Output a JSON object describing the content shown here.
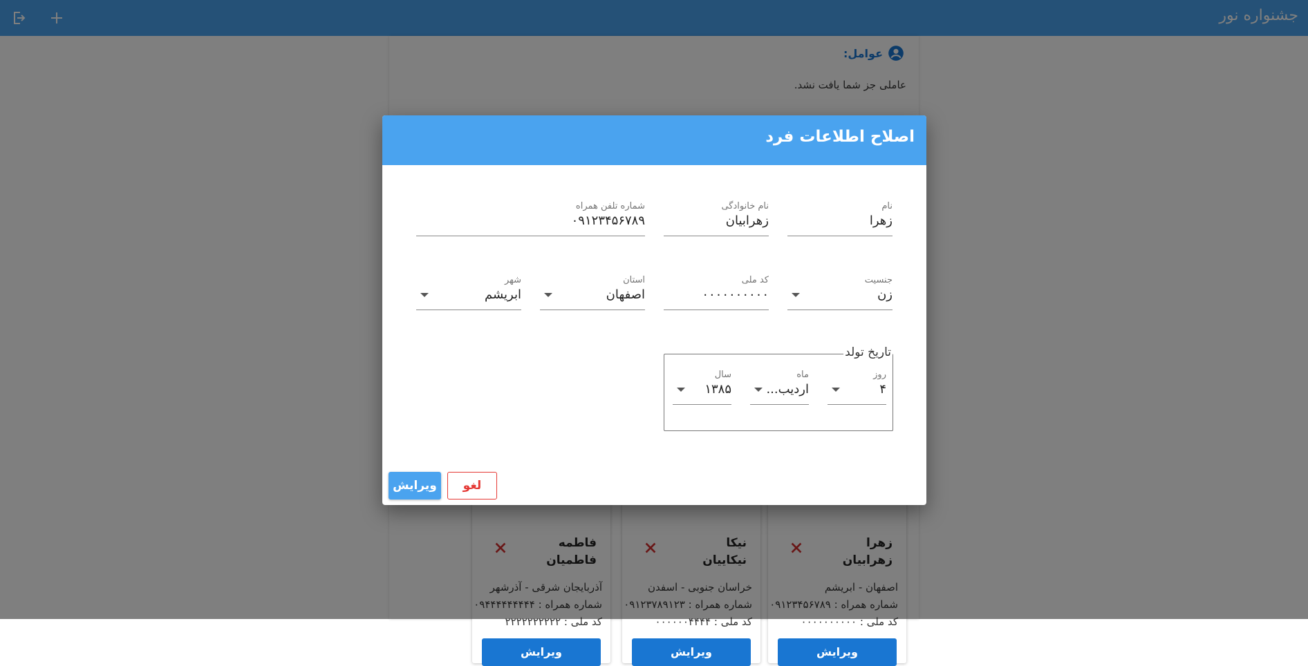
{
  "appbar": {
    "title": "جشنواره نور"
  },
  "background": {
    "section_title": "عوامل:",
    "empty_message": "عاملی جز شما یافت نشد.",
    "cards": [
      {
        "first": "زهرا",
        "last": "زهرابیان",
        "location": "اصفهان - ابریشم",
        "phone": "شماره همراه : ۰۹۱۲۳۴۵۶۷۸۹",
        "national": "کد ملی : ۰۰۰۰۰۰۰۰۰۰",
        "edit": "ویرایش"
      },
      {
        "first": "نیکا",
        "last": "نیکاییان",
        "location": "خراسان جنوبی - اسفدن",
        "phone": "شماره همراه : ۰۹۱۲۳۷۸۹۱۲۳",
        "national": "کد ملی : ۰۰۰۰۰۰۴۴۴۴",
        "edit": "ویرایش"
      },
      {
        "first": "فاطمه",
        "last": "فاطمیان",
        "location": "آذربایجان شرقی - آذرشهر",
        "phone": "شماره همراه : ۰۹۴۴۴۴۴۴۴۴۴",
        "national": "کد ملی : ۲۲۲۲۲۲۲۲۲۲",
        "edit": "ویرایش"
      }
    ]
  },
  "dialog": {
    "title": "اصلاح اطلاعات فرد",
    "fields": {
      "first_name": {
        "label": "نام",
        "value": "زهرا"
      },
      "last_name": {
        "label": "نام خانوادگی",
        "value": "زهرابیان"
      },
      "mobile": {
        "label": "شماره تلفن همراه",
        "value": "۰۹۱۲۳۴۵۶۷۸۹"
      },
      "gender": {
        "label": "جنسیت",
        "value": "زن"
      },
      "national_code": {
        "label": "کد ملی",
        "value": "۰۰۰۰۰۰۰۰۰۰"
      },
      "province": {
        "label": "استان",
        "value": "اصفهان"
      },
      "city": {
        "label": "شهر",
        "value": "ابریشم"
      }
    },
    "birthdate": {
      "legend": "تاریخ تولد",
      "day": {
        "label": "روز",
        "value": "۴"
      },
      "month": {
        "label": "ماه",
        "value": "اردیب..."
      },
      "year": {
        "label": "سال",
        "value": "۱۳۸۵"
      }
    },
    "buttons": {
      "submit": "ویرایش",
      "cancel": "لغو"
    }
  },
  "colors": {
    "primary": "#4aa3ef",
    "danger": "#e53935",
    "card_button": "#1976d2"
  },
  "icons": {
    "logout": "logout-icon",
    "add": "plus-icon",
    "person": "account-circle-icon",
    "delete": "close-icon"
  }
}
